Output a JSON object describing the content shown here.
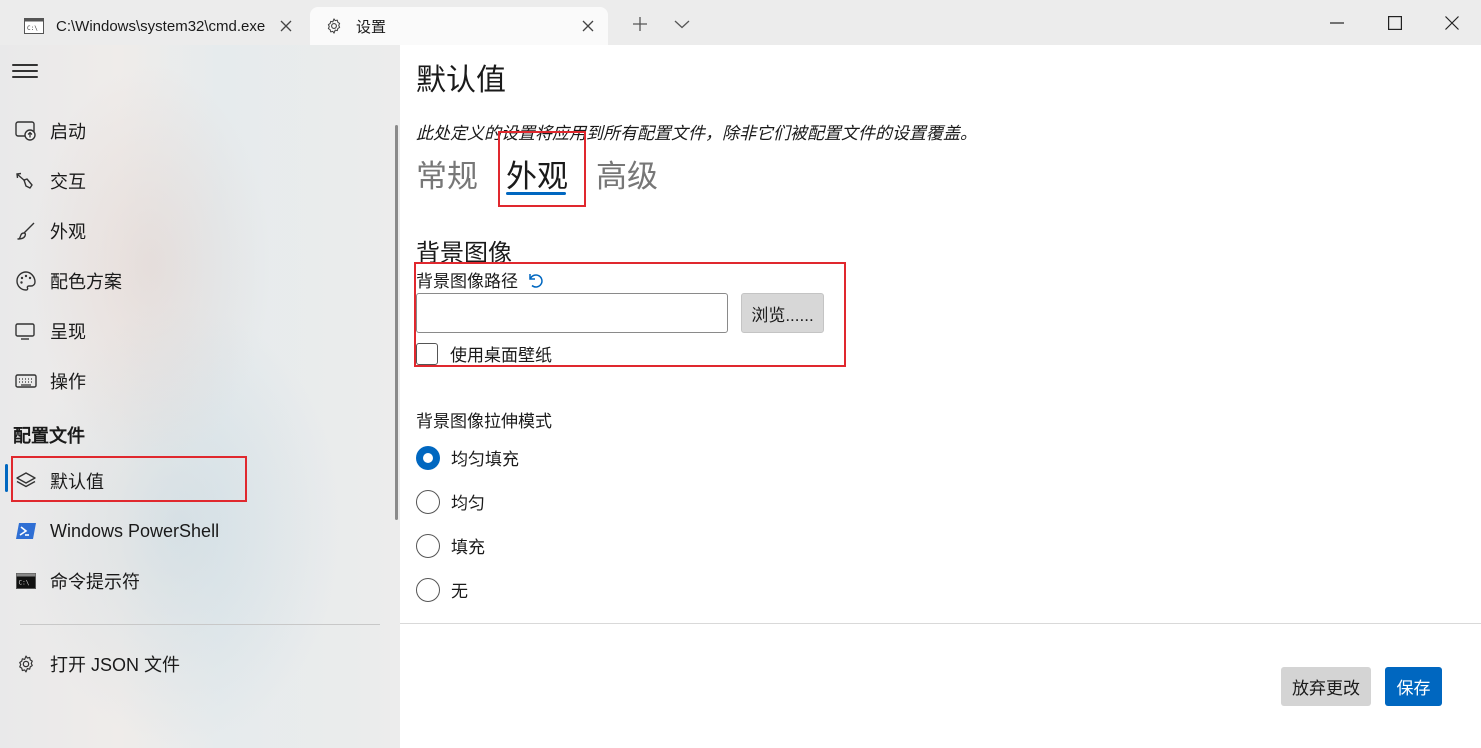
{
  "titlebar": {
    "tabs": [
      {
        "title": "C:\\Windows\\system32\\cmd.exe",
        "icon": "cmd-icon"
      },
      {
        "title": "设置",
        "icon": "gear-icon"
      }
    ]
  },
  "sidebar": {
    "items": [
      {
        "label": "启动",
        "icon": "startup-icon"
      },
      {
        "label": "交互",
        "icon": "interaction-icon"
      },
      {
        "label": "外观",
        "icon": "brush-icon"
      },
      {
        "label": "配色方案",
        "icon": "palette-icon"
      },
      {
        "label": "呈现",
        "icon": "monitor-icon"
      },
      {
        "label": "操作",
        "icon": "keyboard-icon"
      }
    ],
    "profiles_header": "配置文件",
    "profiles": [
      {
        "label": "默认值",
        "icon": "layers-icon",
        "selected": true
      },
      {
        "label": "Windows PowerShell",
        "icon": "powershell-icon"
      },
      {
        "label": "命令提示符",
        "icon": "cmd-icon"
      }
    ],
    "open_json": "打开 JSON 文件"
  },
  "main": {
    "title": "默认值",
    "description": "此处定义的设置将应用到所有配置文件，除非它们被配置文件的设置覆盖。",
    "pivots": [
      {
        "label": "常规",
        "active": false
      },
      {
        "label": "外观",
        "active": true
      },
      {
        "label": "高级",
        "active": false
      }
    ],
    "section_title": "背景图像",
    "path_label": "背景图像路径",
    "path_value": "",
    "browse_label": "浏览......",
    "use_wallpaper_label": "使用桌面壁纸",
    "use_wallpaper_checked": false,
    "stretch_label": "背景图像拉伸模式",
    "stretch_options": [
      {
        "label": "均匀填充",
        "checked": true
      },
      {
        "label": "均匀",
        "checked": false
      },
      {
        "label": "填充",
        "checked": false
      },
      {
        "label": "无",
        "checked": false
      }
    ]
  },
  "footer": {
    "discard_label": "放弃更改",
    "save_label": "保存"
  },
  "colors": {
    "accent": "#0067c0",
    "annotation": "#e0282e"
  }
}
